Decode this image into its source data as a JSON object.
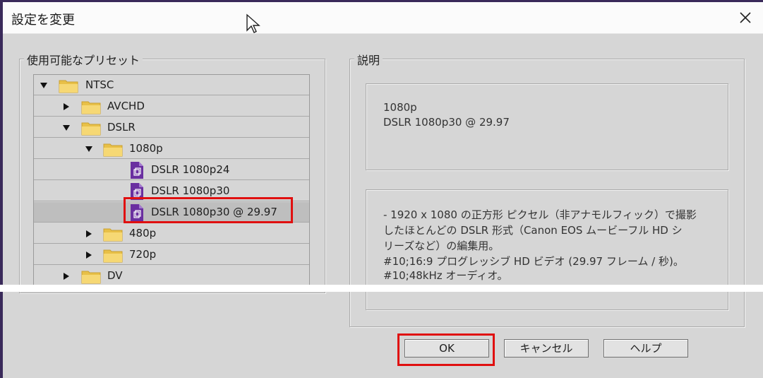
{
  "dialog": {
    "title": "設定を変更"
  },
  "presets": {
    "legend": "使用可能なプリセット",
    "tree": [
      {
        "label": "NTSC",
        "expanded": true,
        "icon": "folder-icon"
      },
      {
        "label": "AVCHD",
        "expanded": false,
        "icon": "folder-icon"
      },
      {
        "label": "DSLR",
        "expanded": true,
        "icon": "folder-icon"
      },
      {
        "label": "1080p",
        "expanded": true,
        "icon": "folder-icon"
      },
      {
        "label": "DSLR 1080p24",
        "icon": "preset-file-icon"
      },
      {
        "label": "DSLR 1080p30",
        "icon": "preset-file-icon"
      },
      {
        "label": "DSLR 1080p30 @ 29.97",
        "icon": "preset-file-icon",
        "selected": true
      },
      {
        "label": "480p",
        "expanded": false,
        "icon": "folder-icon"
      },
      {
        "label": "720p",
        "expanded": false,
        "icon": "folder-icon"
      },
      {
        "label": "DV",
        "expanded": false,
        "icon": "folder-icon"
      }
    ]
  },
  "description": {
    "legend": "説明",
    "summary": [
      "1080p",
      "DSLR 1080p30 @ 29.97"
    ],
    "details": [
      "- 1920 x 1080 の正方形 ピクセル（非アナモルフィック）で撮影",
      "したほとんどの DSLR 形式（Canon EOS ムービーフル HD シ",
      "リーズなど）の編集用。",
      "#10;16:9 プログレッシブ HD ビデオ (29.97 フレーム / 秒)。",
      "#10;48kHz オーディオ。"
    ]
  },
  "buttons": {
    "ok": "OK",
    "cancel": "キャンセル",
    "help": "ヘルプ"
  },
  "colors": {
    "highlight": "#e01010",
    "file_icon": "#6a2fa0",
    "folder_icon": "#f2cf5b"
  }
}
